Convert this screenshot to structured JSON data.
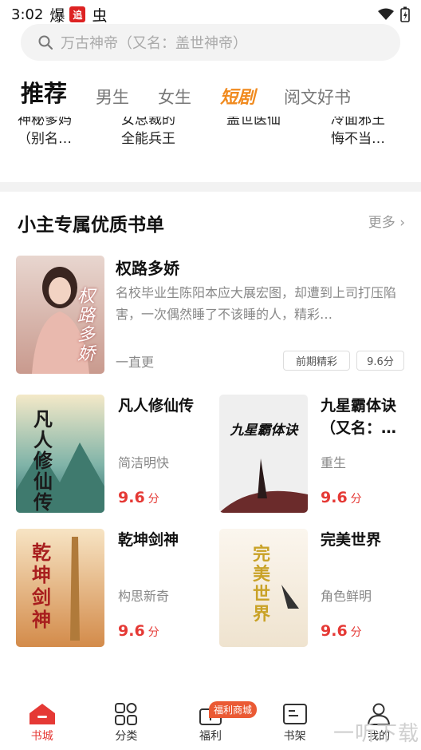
{
  "status_bar": {
    "time": "3:02",
    "notif1": "爆",
    "notif2": "追",
    "notif3": "虫"
  },
  "search": {
    "placeholder": "万古神帝（又名：盖世神帝）"
  },
  "tabs": [
    {
      "label": "推荐"
    },
    {
      "label": "男生"
    },
    {
      "label": "女生"
    },
    {
      "label": "短剧"
    },
    {
      "label": "阅文好书"
    }
  ],
  "cut_row": [
    {
      "line1": "神秘爹妈",
      "line2": "（别名…"
    },
    {
      "line1": "女总裁的",
      "line2": "全能兵王"
    },
    {
      "line1": "盖世医仙",
      "line2": ""
    },
    {
      "line1": "冷面邪王",
      "line2": "悔不当…"
    }
  ],
  "section": {
    "title": "小主专属优质书单",
    "more": "更多"
  },
  "featured": {
    "title": "权路多娇",
    "cover_text": "权路多娇",
    "desc": "名校毕业生陈阳本应大展宏图，却遭到上司打压陷害，一次偶然睡了不该睡的人，精彩…",
    "author": "一直更",
    "tags": [
      "前期精彩",
      "9.6分"
    ]
  },
  "books": [
    {
      "title": "凡人修仙传",
      "tag": "简洁明快",
      "score": "9.6",
      "unit": "分",
      "cover_text": "凡人修仙传"
    },
    {
      "title": "九星霸体诀（又名：…",
      "tag": "重生",
      "score": "9.6",
      "unit": "分",
      "cover_text": "九星霸体诀"
    },
    {
      "title": "乾坤剑神",
      "tag": "构思新奇",
      "score": "9.6",
      "unit": "分",
      "cover_text": "乾坤剑神"
    },
    {
      "title": "完美世界",
      "tag": "角色鲜明",
      "score": "9.6",
      "unit": "分",
      "cover_text": "完美世界"
    }
  ],
  "bottom_nav": [
    {
      "label": "书城"
    },
    {
      "label": "分类"
    },
    {
      "label": "福利",
      "badge": "福利商城"
    },
    {
      "label": "书架"
    },
    {
      "label": "我的"
    }
  ],
  "watermark": "一听下载",
  "colors": {
    "accent": "#e53935",
    "hot_tab": "#f08a1e"
  }
}
